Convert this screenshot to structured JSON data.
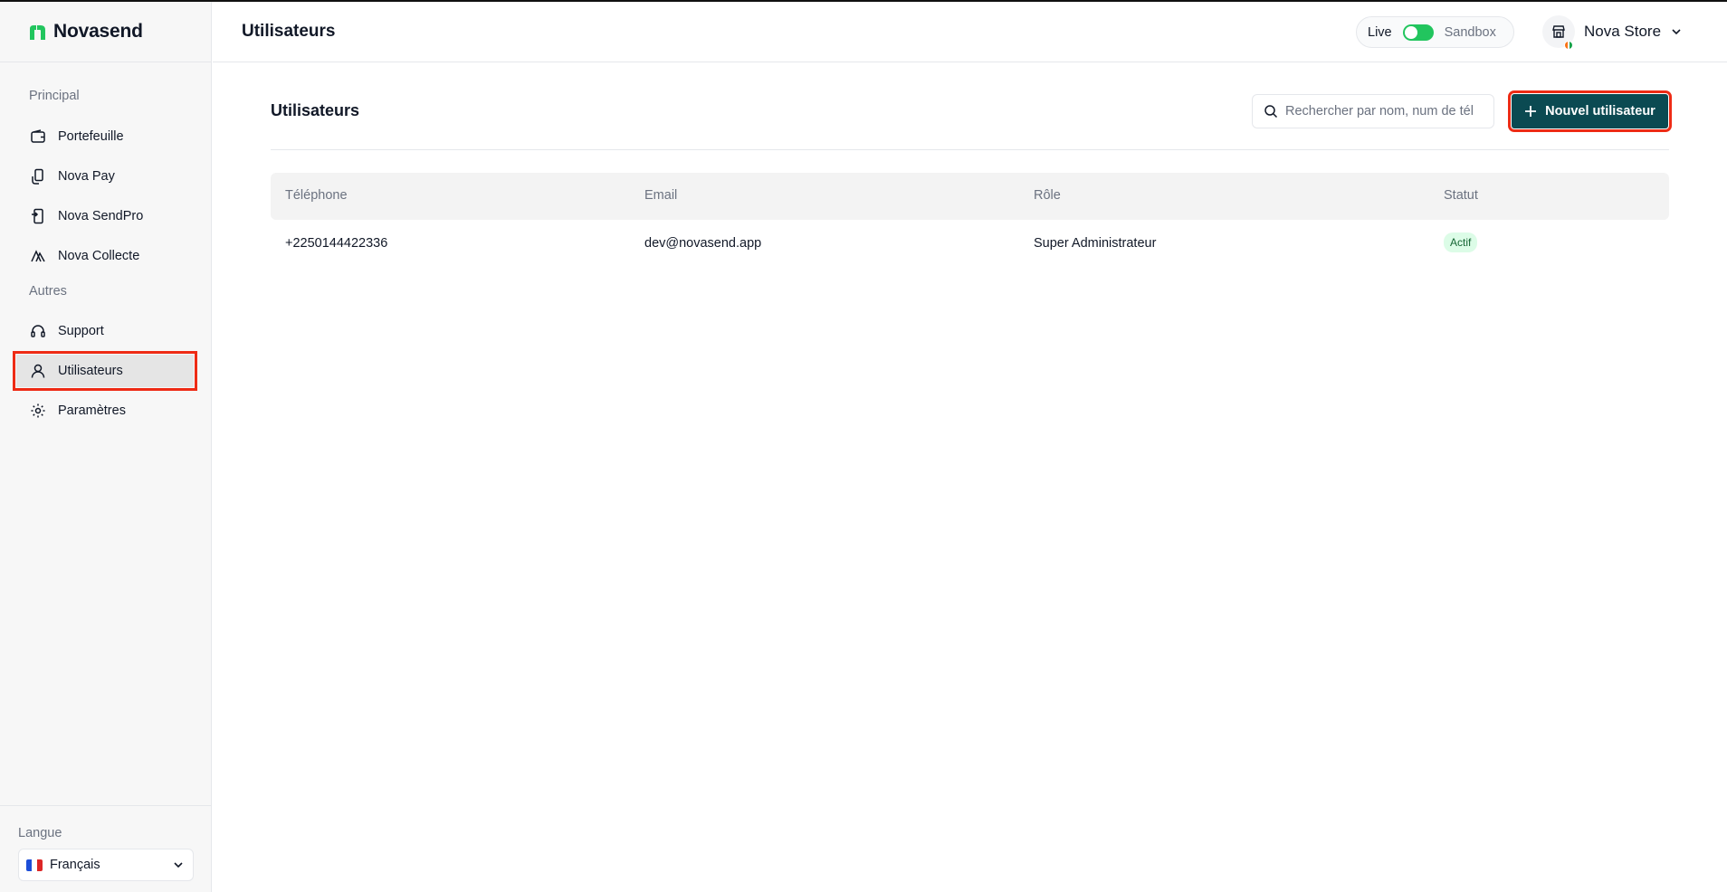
{
  "brand": {
    "name": "Novasend",
    "accent": "#22c55e"
  },
  "sidebar": {
    "sections": [
      {
        "title": "Principal"
      },
      {
        "title": "Autres"
      }
    ],
    "items": [
      {
        "label": "Portefeuille",
        "icon": "wallet-icon"
      },
      {
        "label": "Nova Pay",
        "icon": "hand-phone-icon"
      },
      {
        "label": "Nova SendPro",
        "icon": "phone-transfer-icon"
      },
      {
        "label": "Nova Collecte",
        "icon": "collect-icon"
      },
      {
        "label": "Support",
        "icon": "headset-icon"
      },
      {
        "label": "Utilisateurs",
        "icon": "user-icon",
        "active": true
      },
      {
        "label": "Paramètres",
        "icon": "gear-icon"
      }
    ],
    "language": {
      "title": "Langue",
      "selected": "Français",
      "flag_icon": "france-flag-icon"
    }
  },
  "header": {
    "title": "Utilisateurs",
    "env_toggle": {
      "left_label": "Live",
      "right_label": "Sandbox",
      "on": true
    },
    "account": {
      "name": "Nova Store",
      "avatar_icon": "store-icon"
    }
  },
  "main": {
    "title": "Utilisateurs",
    "search": {
      "placeholder": "Rechercher par nom, num de tél",
      "value": ""
    },
    "new_user_label": "Nouvel utilisateur",
    "table": {
      "columns": [
        "Téléphone",
        "Email",
        "Rôle",
        "Statut"
      ],
      "rows": [
        {
          "phone": "+2250144422336",
          "email": "dev@novasend.app",
          "role": "Super Administrateur",
          "status": "Actif"
        }
      ]
    }
  },
  "colors": {
    "primary_button": "#0b4a52",
    "highlight_outline": "#ee2b15",
    "status_active_bg": "#dcfce7",
    "status_active_text": "#166534"
  }
}
